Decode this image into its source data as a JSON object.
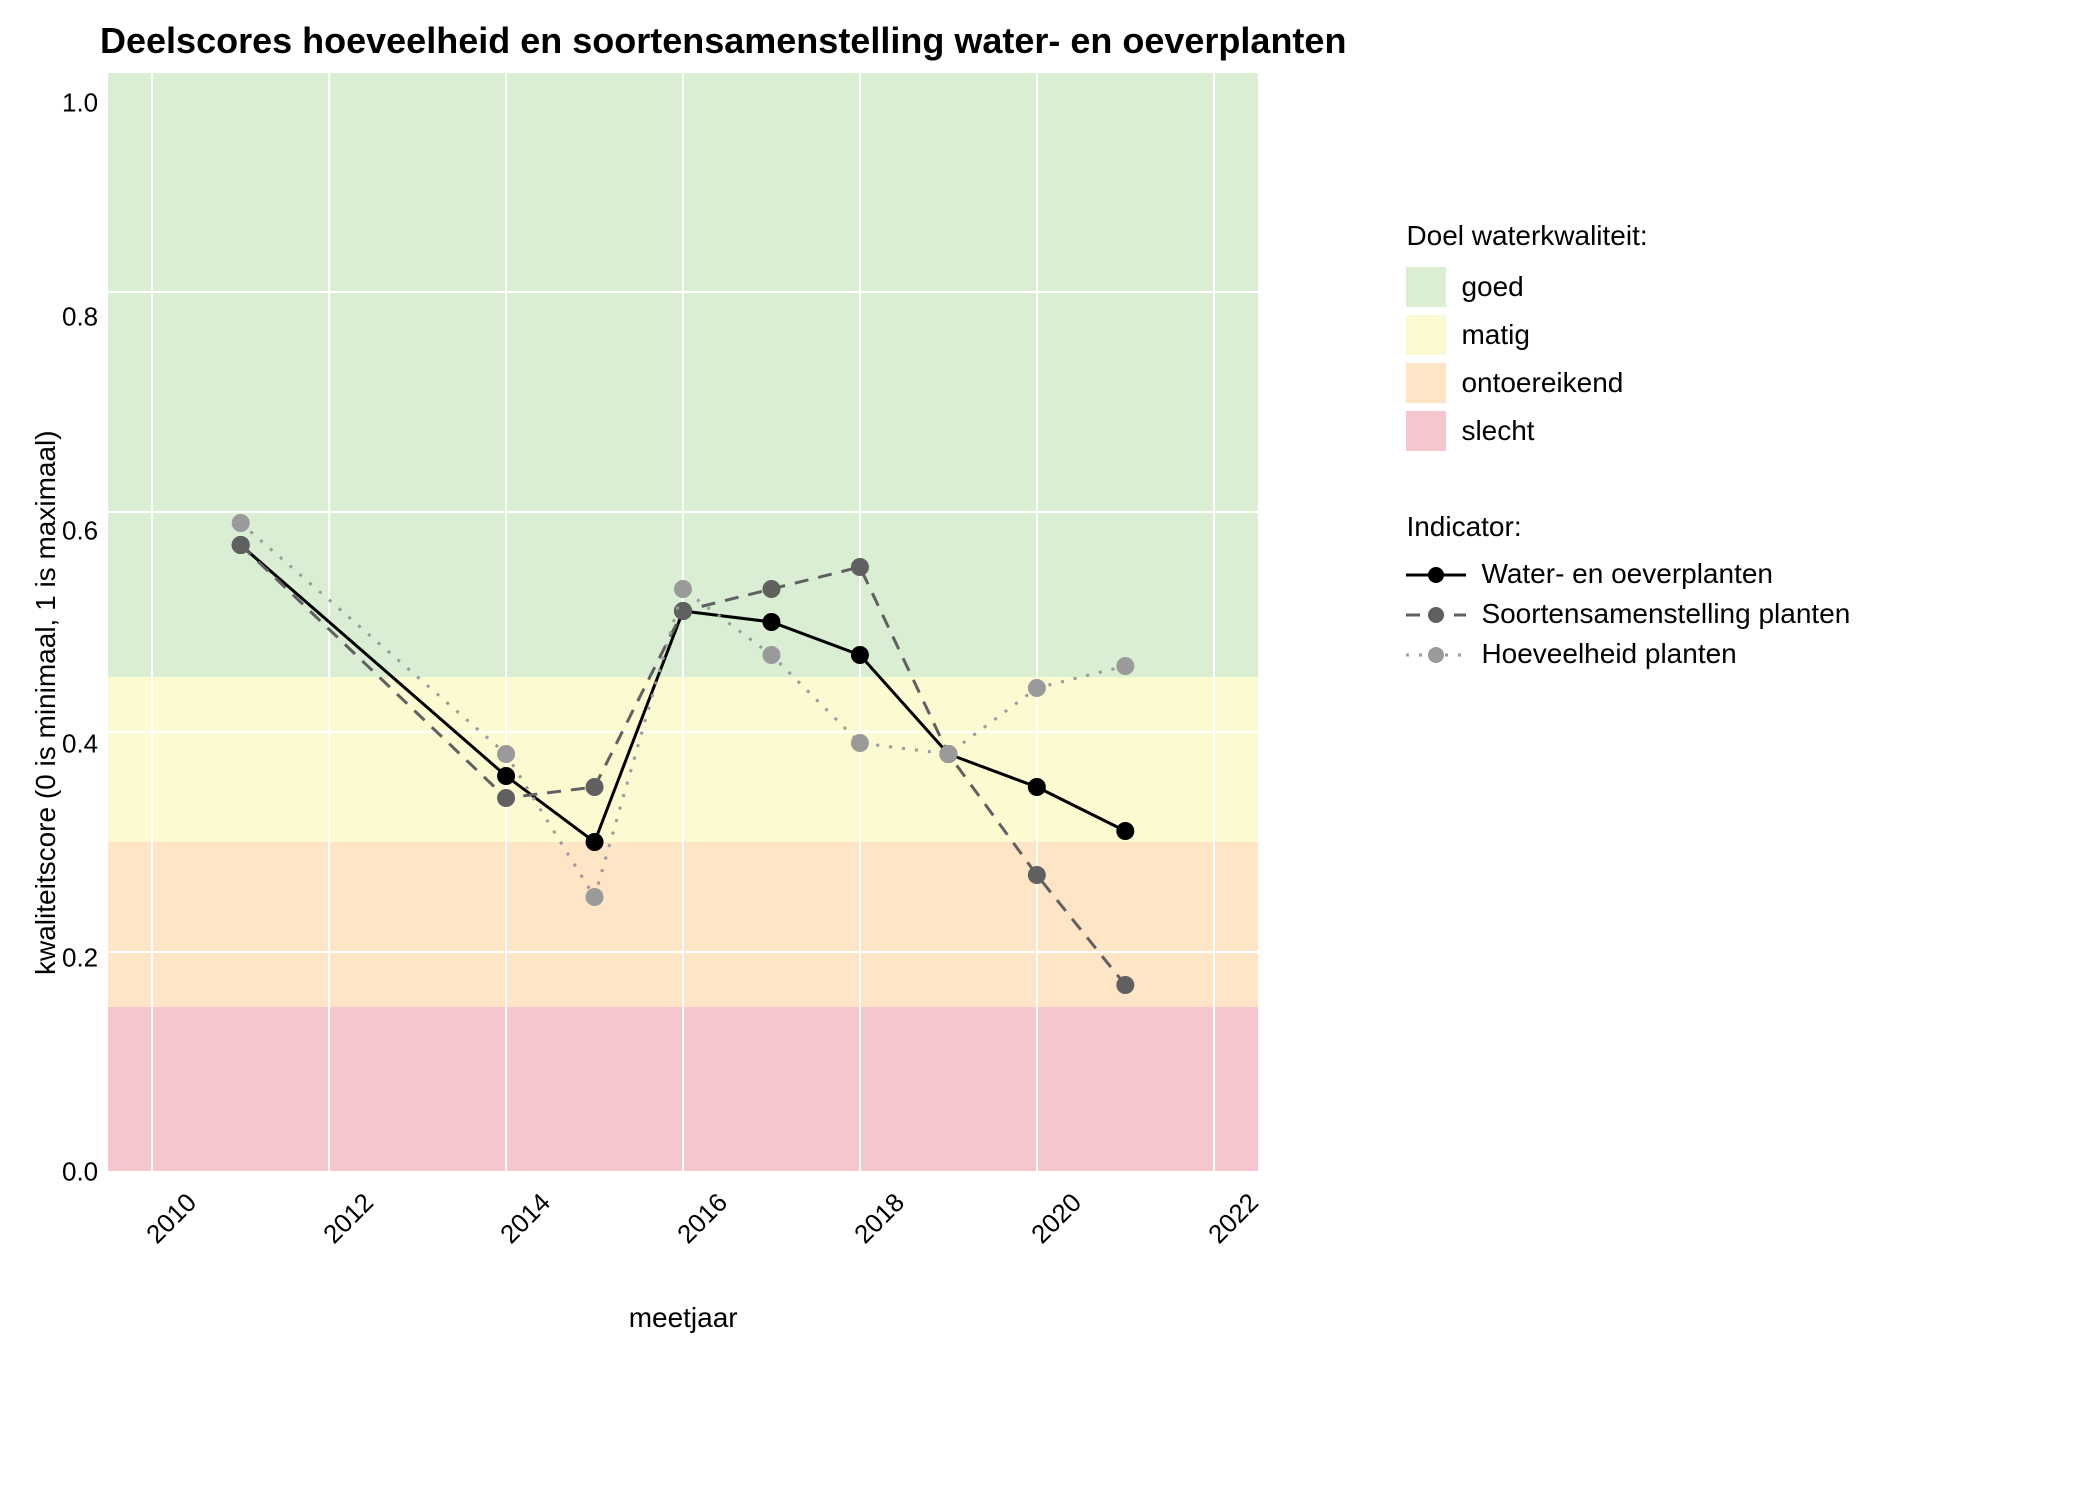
{
  "chart_data": {
    "type": "line",
    "title": "Deelscores hoeveelheid en soortensamenstelling water- en oeverplanten",
    "xlabel": "meetjaar",
    "ylabel": "kwaliteitscore (0 is minimaal, 1 is maximaal)",
    "x": [
      2011,
      2014,
      2015,
      2016,
      2017,
      2018,
      2019,
      2020,
      2021
    ],
    "x_ticks": [
      2010,
      2012,
      2014,
      2016,
      2018,
      2020,
      2022
    ],
    "y_ticks": [
      0.0,
      0.2,
      0.4,
      0.6,
      0.8,
      1.0
    ],
    "xlim": [
      2009.5,
      2022.5
    ],
    "ylim": [
      0.0,
      1.0
    ],
    "series": [
      {
        "name": "Water- en oeverplanten",
        "style": "solid",
        "color": "#000000",
        "values": [
          0.57,
          0.36,
          0.3,
          0.51,
          0.5,
          0.47,
          0.38,
          0.35,
          0.31
        ]
      },
      {
        "name": "Soortensamenstelling planten",
        "style": "dashed",
        "color": "#606060",
        "values": [
          0.57,
          0.34,
          0.35,
          0.51,
          0.53,
          0.55,
          0.38,
          0.27,
          0.17
        ]
      },
      {
        "name": "Hoeveelheid planten",
        "style": "dotted",
        "color": "#9a9a9a",
        "values": [
          0.59,
          0.38,
          0.25,
          0.53,
          0.47,
          0.39,
          0.38,
          0.44,
          0.46
        ]
      }
    ],
    "bands": [
      {
        "label": "goed",
        "from": 0.45,
        "to": 1.0,
        "color": "#d9eed2"
      },
      {
        "label": "matig",
        "from": 0.3,
        "to": 0.45,
        "color": "#fcfad0"
      },
      {
        "label": "ontoereikend",
        "from": 0.15,
        "to": 0.3,
        "color": "#fde5c6"
      },
      {
        "label": "slecht",
        "from": 0.0,
        "to": 0.15,
        "color": "#f6c6ce"
      }
    ],
    "legend_quality_title": "Doel waterkwaliteit:",
    "legend_indicator_title": "Indicator:"
  }
}
